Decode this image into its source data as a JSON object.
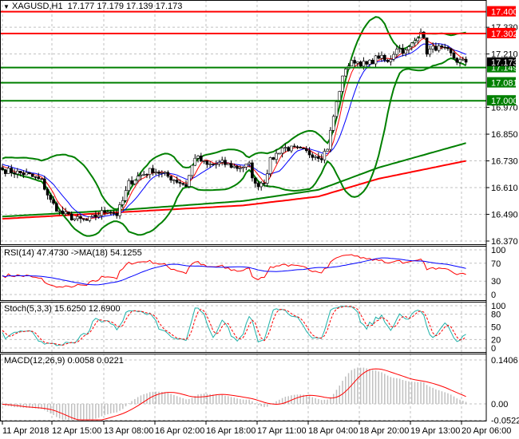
{
  "header": {
    "symbol": "XAGUSD,H1",
    "ohlc": "17.177 17.179 17.139 17.173",
    "menu_icon": "triangle-down-icon"
  },
  "chart_data": {
    "type": "candlestick",
    "title": "XAGUSD,H1",
    "last_price": "17.173",
    "ylim": [
      16.37,
      17.45
    ],
    "price_ticks": [
      "17.330",
      "17.210",
      "16.970",
      "16.850",
      "16.730",
      "16.610",
      "16.490",
      "16.370"
    ],
    "time_labels": [
      "11 Apr 2018",
      "12 Apr 15:00",
      "13 Apr 08:00",
      "16 Apr 02:00",
      "16 Apr 18:00",
      "17 Apr 11:00",
      "18 Apr 04:00",
      "18 Apr 20:00",
      "19 Apr 13:00",
      "20 Apr 06:00"
    ],
    "bar_count": 155,
    "price_path": [
      [
        0,
        16.69
      ],
      [
        8,
        16.67
      ],
      [
        13,
        16.64
      ],
      [
        16,
        16.55
      ],
      [
        19,
        16.5
      ],
      [
        24,
        16.47
      ],
      [
        28,
        16.46
      ],
      [
        32,
        16.49
      ],
      [
        35,
        16.51
      ],
      [
        38,
        16.49
      ],
      [
        40,
        16.55
      ],
      [
        42,
        16.63
      ],
      [
        45,
        16.66
      ],
      [
        50,
        16.69
      ],
      [
        55,
        16.66
      ],
      [
        58,
        16.64
      ],
      [
        61,
        16.62
      ],
      [
        64,
        16.75
      ],
      [
        68,
        16.71
      ],
      [
        73,
        16.72
      ],
      [
        78,
        16.7
      ],
      [
        82,
        16.71
      ],
      [
        84,
        16.62
      ],
      [
        87,
        16.64
      ],
      [
        89,
        16.73
      ],
      [
        93,
        16.79
      ],
      [
        98,
        16.78
      ],
      [
        103,
        16.76
      ],
      [
        106,
        16.75
      ],
      [
        108,
        16.79
      ],
      [
        110,
        16.93
      ],
      [
        112,
        17.05
      ],
      [
        114,
        17.15
      ],
      [
        117,
        17.18
      ],
      [
        121,
        17.16
      ],
      [
        125,
        17.2
      ],
      [
        128,
        17.17
      ],
      [
        131,
        17.24
      ],
      [
        134,
        17.22
      ],
      [
        137,
        17.27
      ],
      [
        139,
        17.32
      ],
      [
        141,
        17.22
      ],
      [
        144,
        17.24
      ],
      [
        148,
        17.22
      ],
      [
        151,
        17.18
      ],
      [
        154,
        17.173
      ]
    ],
    "ma_long_red": [
      [
        0,
        16.47
      ],
      [
        40,
        16.5
      ],
      [
        80,
        16.53
      ],
      [
        105,
        16.57
      ],
      [
        125,
        16.65
      ],
      [
        154,
        16.73
      ]
    ],
    "ma_long_green": [
      [
        0,
        16.48
      ],
      [
        40,
        16.51
      ],
      [
        80,
        16.55
      ],
      [
        105,
        16.6
      ],
      [
        125,
        16.7
      ],
      [
        154,
        16.81
      ]
    ],
    "levels": [
      {
        "price": 17.4,
        "label": "17.400",
        "color": "#ff0000"
      },
      {
        "price": 17.302,
        "label": "17.302",
        "color": "#ff0000"
      },
      {
        "price": 17.149,
        "label": "17.149",
        "color": "#008000"
      },
      {
        "price": 17.081,
        "label": "17.081",
        "color": "#008000"
      },
      {
        "price": 17.0,
        "label": "17.000",
        "color": "#008000"
      }
    ],
    "rsi": {
      "label": "RSI(14) 47.4730  ->MA(18) 54.1255",
      "ticks": [
        "100",
        "70",
        "30",
        "0"
      ],
      "color": "#ff0000",
      "ma_color": "#0000ff"
    },
    "stoch": {
      "label": "Stoch(5,3,3) 15.6250 12.6900",
      "ticks": [
        "100",
        "80",
        "50",
        "20",
        "0"
      ],
      "main_color": "#20b2aa",
      "signal_color": "#ff0000"
    },
    "macd": {
      "label": "MACD(12,26,9) 0.0058 0.0221",
      "ticks": [
        "0.1406",
        "0.00",
        "-0.0522"
      ],
      "hist_color": "#c0c0c0",
      "signal_color": "#ff0000"
    }
  }
}
